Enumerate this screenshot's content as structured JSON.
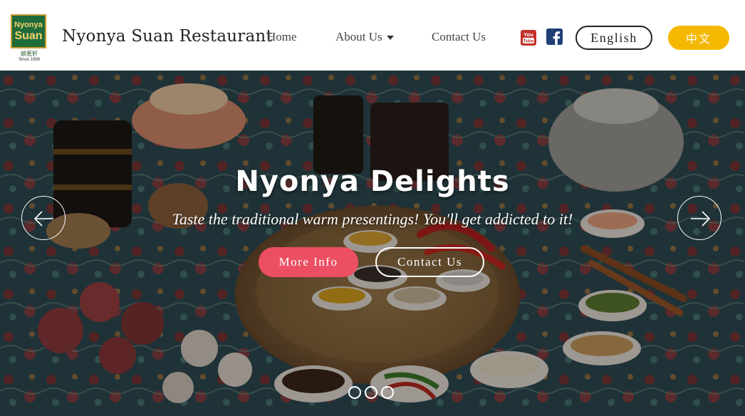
{
  "header": {
    "logo": {
      "line1": "Nyonya",
      "line2": "Suan",
      "chinese": "娘惹轩",
      "since": "Since 1998"
    },
    "brand_name": "Nyonya Suan Restaurant",
    "nav": {
      "home": "Home",
      "about": "About Us",
      "contact": "Contact Us"
    },
    "social": [
      "youtube-icon",
      "facebook-icon"
    ],
    "lang_english": "English",
    "lang_chinese": "中文"
  },
  "hero": {
    "title": "Nyonya Delights",
    "subtitle": "Taste the traditional warm presentings! You'll get addicted to it!",
    "more_info": "More Info",
    "contact_us": "Contact Us",
    "slides": 3,
    "active_slide": 1
  },
  "colors": {
    "accent_pink": "#ec4f63",
    "accent_yellow": "#f5b800",
    "youtube_red": "#c4302b",
    "facebook_blue": "#1f3f74"
  }
}
